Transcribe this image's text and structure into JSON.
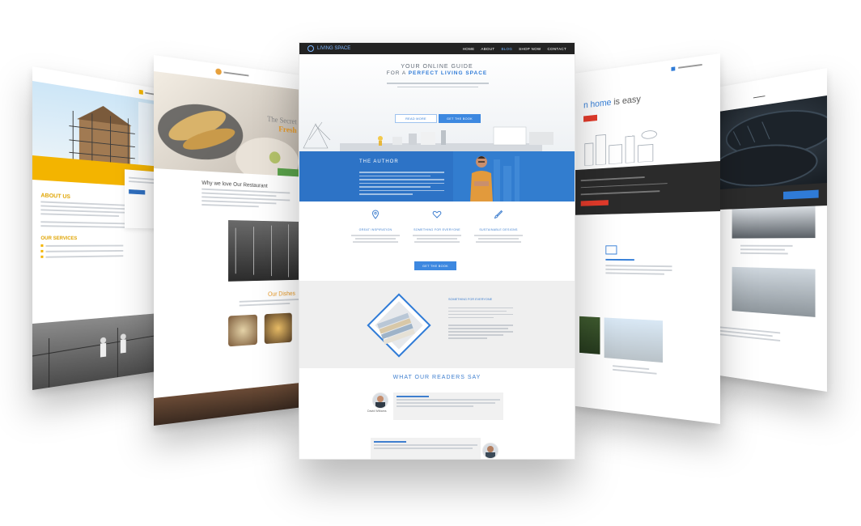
{
  "center": {
    "nav": {
      "brand": "LIVING SPACE",
      "menu": [
        "HOME",
        "ABOUT",
        "BLOG",
        "SHOP NOW",
        "CONTACT"
      ],
      "active_index": 2
    },
    "hero": {
      "line1": "YOUR ONLINE GUIDE",
      "line2_prefix": "FOR A",
      "line2_emph": "PERFECT LIVING SPACE",
      "btn_left": "READ MORE",
      "btn_right": "GET THE BOOK"
    },
    "author": {
      "title": "THE AUTHOR"
    },
    "features": [
      {
        "title": "GREAT INSPIRATION",
        "icon": "location-pin-icon"
      },
      {
        "title": "SOMETHING FOR EVERYONE",
        "icon": "heart-icon"
      },
      {
        "title": "SUSTAINABLE DESIGNS",
        "icon": "brush-icon"
      }
    ],
    "features_btn": "GET THE BOOK",
    "gray": {
      "title": "SOMETHING FOR EVERYONE"
    },
    "readers": {
      "title": "WHAT OUR READERS SAY",
      "name1": "David Williams"
    }
  },
  "left2": {
    "title1": "The Secret",
    "title2": "Fresh",
    "heading": "Why we love Our Restaurant",
    "section2": "Our Dishes"
  },
  "left1": {
    "about": "ABOUT US",
    "services": "OUR SERVICES"
  },
  "right1": {
    "heading_emph": "n home",
    "heading_rest": " is easy"
  },
  "colors": {
    "accent": "#2d73c6",
    "orange": "#f3b400",
    "red": "#e43b2b",
    "dark": "#232323"
  }
}
